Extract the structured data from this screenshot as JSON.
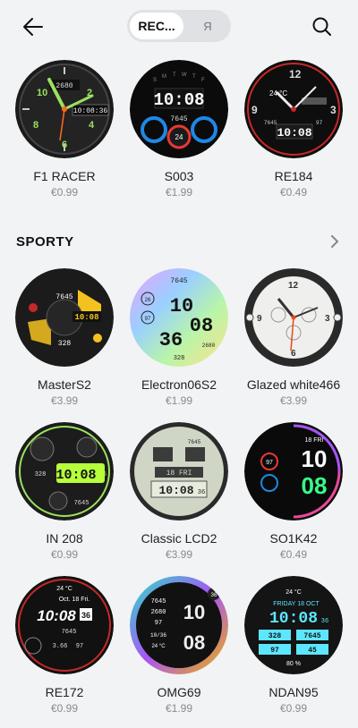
{
  "header": {
    "tab_active": "REC...",
    "tab_other": "Я",
    "back_icon": "arrow-left-icon",
    "search_icon": "search-icon"
  },
  "featured": [
    {
      "name": "F1 RACER",
      "price": "€0.99"
    },
    {
      "name": "S003",
      "price": "€1.99"
    },
    {
      "name": "RE184",
      "price": "€0.49"
    }
  ],
  "sporty": {
    "title": "SPORTY",
    "more_icon": "chevron-right-icon",
    "items": [
      {
        "name": "MasterS2",
        "price": "€3.99"
      },
      {
        "name": "Electron06S2",
        "price": "€1.99"
      },
      {
        "name": "Glazed white466",
        "price": "€3.99"
      },
      {
        "name": "IN 208",
        "price": "€0.99"
      },
      {
        "name": "Classic LCD2",
        "price": "€3.99"
      },
      {
        "name": "SO1K42",
        "price": "€0.49"
      },
      {
        "name": "RE172",
        "price": "€0.99"
      },
      {
        "name": "OMG69",
        "price": "€1.99"
      },
      {
        "name": "NDAN95",
        "price": "€0.99"
      }
    ]
  },
  "faces": {
    "f1_time": "10:08:36",
    "f1_small": "2680",
    "s003_time": "10:08",
    "s003_steps": "7645",
    "s003_temp": "24",
    "re184_temp": "24 °C",
    "re184_time": "10:08",
    "re184_steps": "7645",
    "re184_hr": "97",
    "masters2_top": "7645",
    "masters2_time": "10:08",
    "masters2_bottom": "328",
    "electron_steps": "7645",
    "electron_h": "10",
    "electron_m": "08",
    "electron_s": "36",
    "electron_hr": "97",
    "electron_pct": "26",
    "electron_step2": "2680",
    "electron_bottom": "328",
    "in208_time": "10:08",
    "in208_secs": "36",
    "in208_kcal": "328",
    "in208_steps": "7645",
    "lcd_date": "18 FRI",
    "lcd_time": "10:08",
    "lcd_secs": "36",
    "lcd_steps": "7645",
    "so1k_date": "18 FRI",
    "so1k_h": "10",
    "so1k_m": "08",
    "so1k_hr": "97",
    "re172_temp": "24 °C",
    "re172_date": "Oct. 18 Fri.",
    "re172_time": "10:08",
    "re172_secs": "36",
    "re172_steps": "7645",
    "re172_km": "3.66",
    "re172_hr": "97",
    "omg_steps": "7645",
    "omg_b": "2680",
    "omg_c": "97",
    "omg_date": "10/36",
    "omg_temp": "24 °C",
    "omg_h": "10",
    "omg_m": "08",
    "omg_sec": "36",
    "ndan_temp": "24 °C",
    "ndan_date": "FRIDAY 18 OCT",
    "ndan_time": "10:08",
    "ndan_secs": "36",
    "ndan_a": "328",
    "ndan_b": "7645",
    "ndan_c": "97",
    "ndan_d": "45",
    "ndan_pct": "80 %"
  }
}
